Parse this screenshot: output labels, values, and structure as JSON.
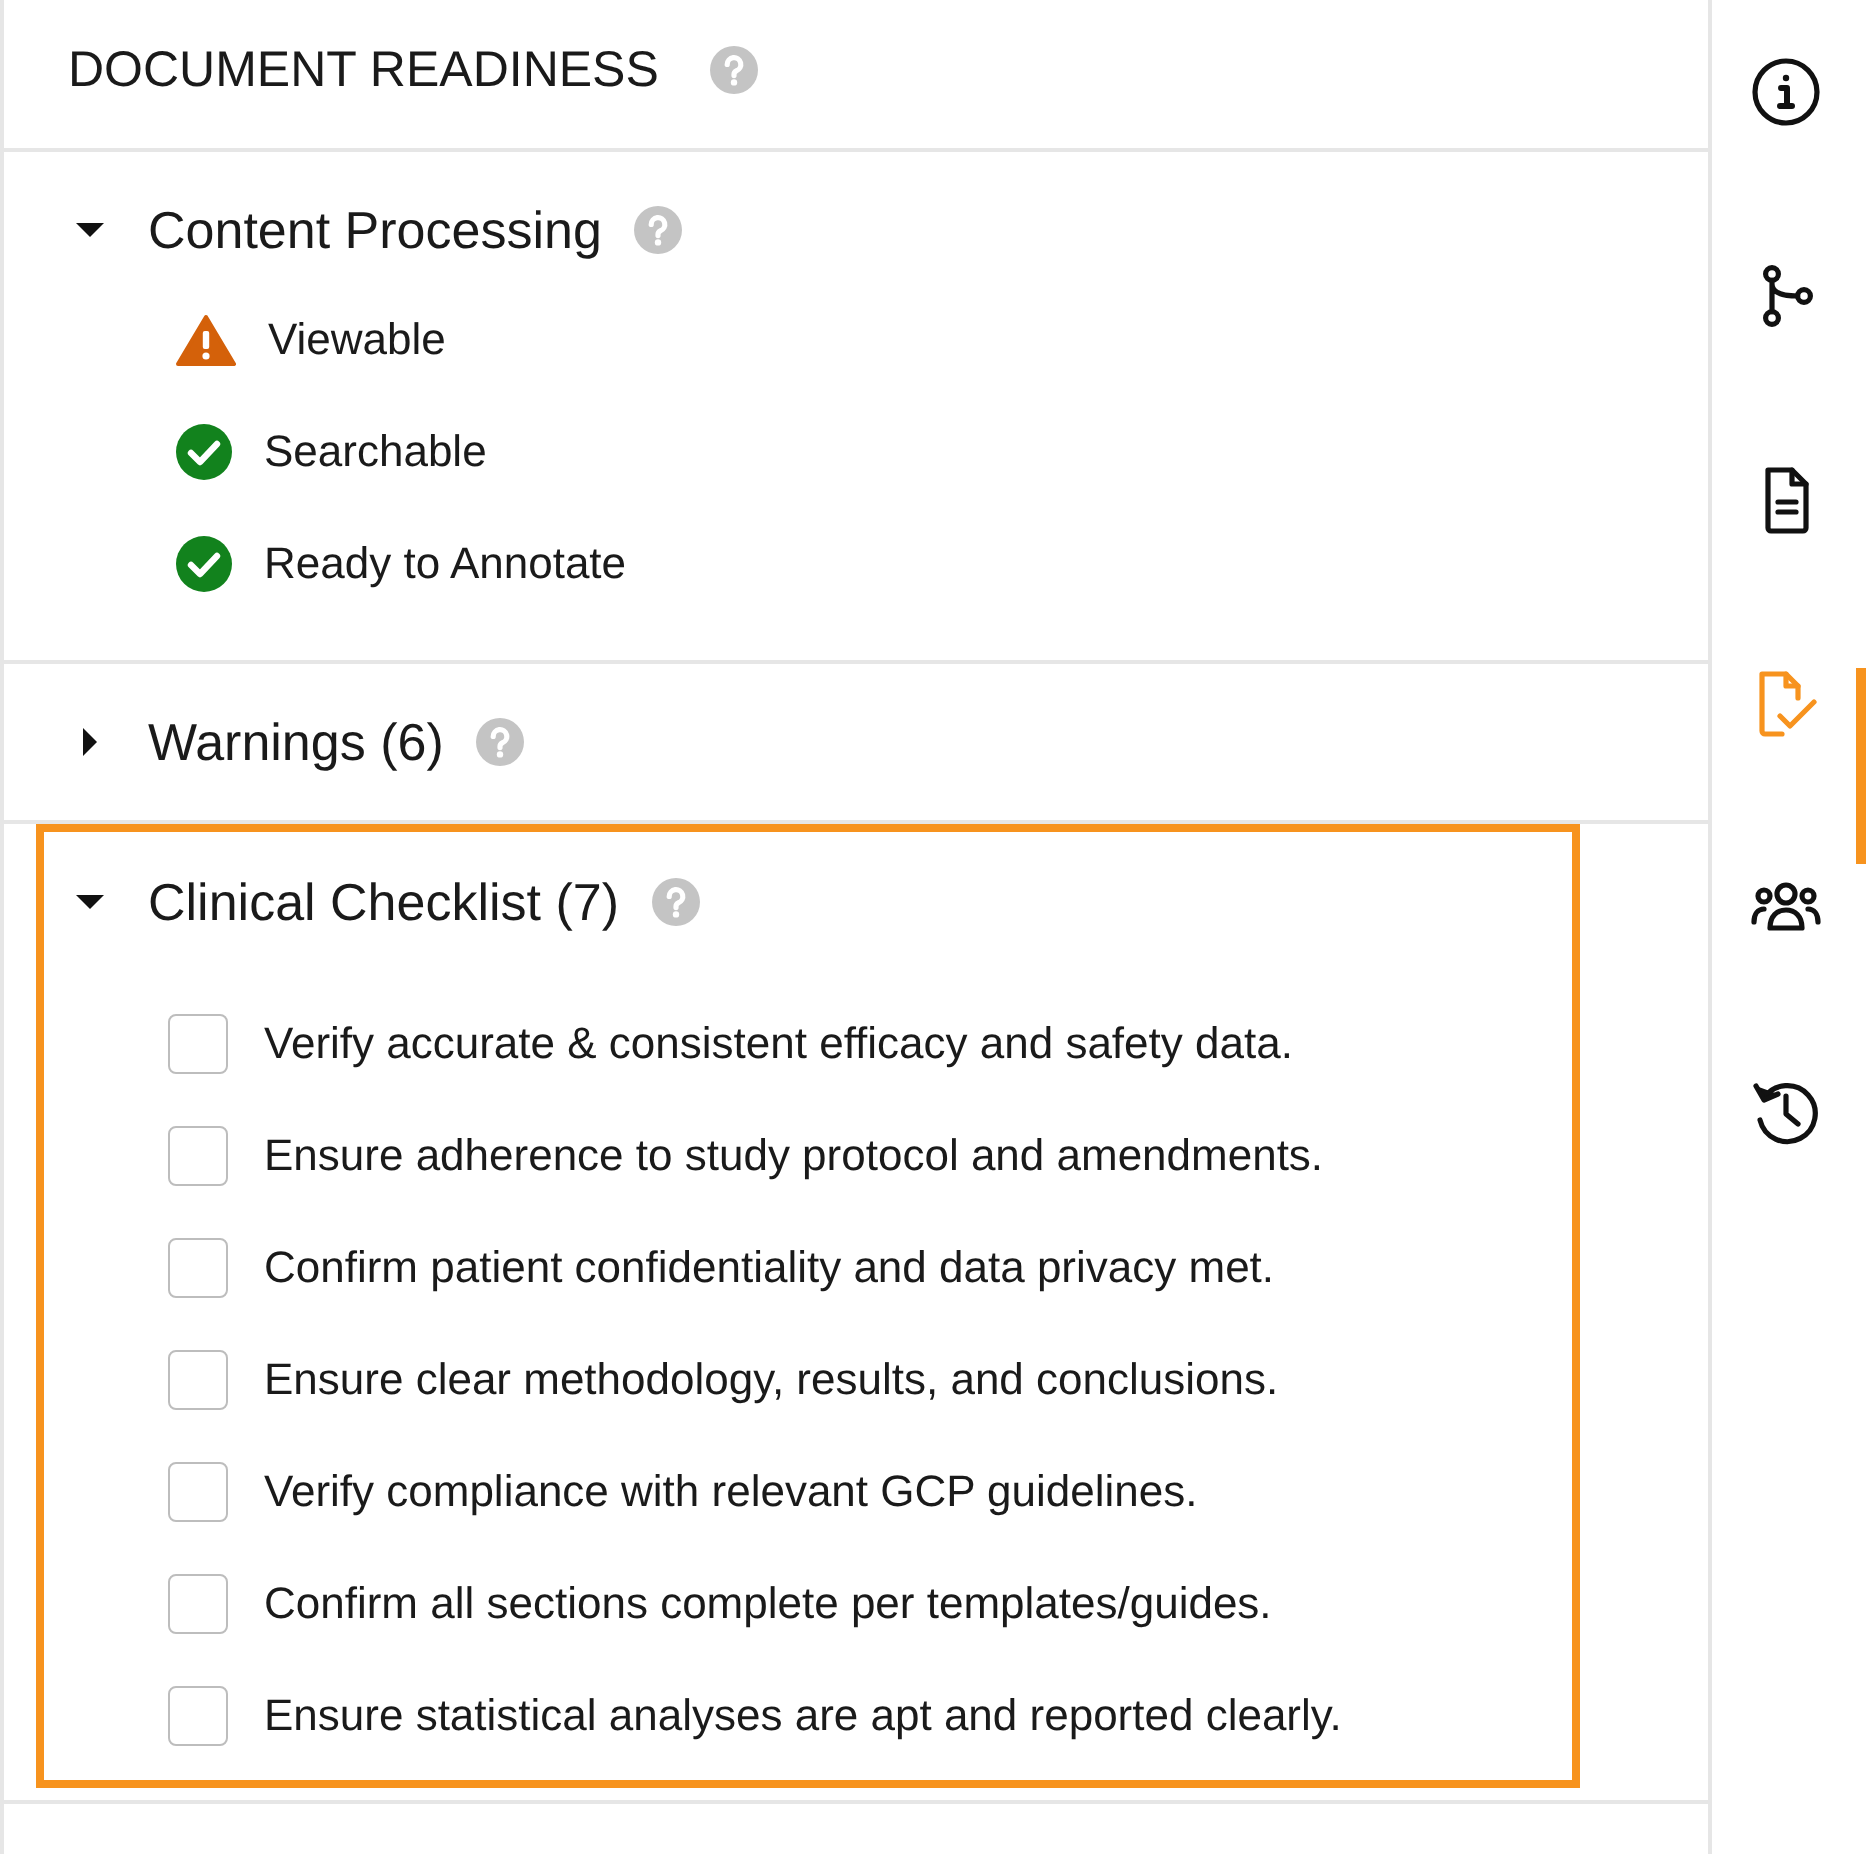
{
  "panel": {
    "title": "DOCUMENT READINESS"
  },
  "sections": [
    {
      "title": "Content Processing",
      "expanded": true,
      "highlighted": false,
      "items": [
        {
          "label": "Viewable",
          "kind": "warning"
        },
        {
          "label": "Searchable",
          "kind": "ok"
        },
        {
          "label": "Ready to Annotate",
          "kind": "ok"
        }
      ]
    },
    {
      "title": "Warnings (6)",
      "expanded": false,
      "highlighted": false
    },
    {
      "title": "Clinical Checklist (7)",
      "expanded": true,
      "highlighted": true,
      "items": [
        {
          "label": "Verify accurate & consistent efficacy and safety data.",
          "kind": "checkbox",
          "checked": false
        },
        {
          "label": "Ensure adherence to study protocol and amendments.",
          "kind": "checkbox",
          "checked": false
        },
        {
          "label": "Confirm patient confidentiality and data privacy met.",
          "kind": "checkbox",
          "checked": false
        },
        {
          "label": "Ensure clear methodology, results, and conclusions.",
          "kind": "checkbox",
          "checked": false
        },
        {
          "label": "Verify compliance with relevant GCP guidelines.",
          "kind": "checkbox",
          "checked": false
        },
        {
          "label": "Confirm all sections complete per templates/guides.",
          "kind": "checkbox",
          "checked": false
        },
        {
          "label": "Ensure statistical analyses are apt and reported clearly.",
          "kind": "checkbox",
          "checked": false
        }
      ]
    }
  ],
  "rail": [
    {
      "selected": false
    },
    {
      "selected": false
    },
    {
      "selected": false
    },
    {
      "selected": true
    },
    {
      "selected": false
    },
    {
      "selected": false
    }
  ]
}
